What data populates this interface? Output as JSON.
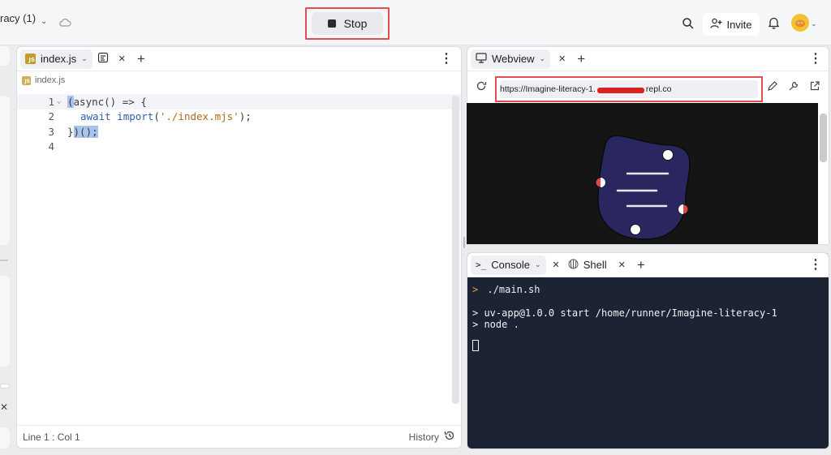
{
  "topbar": {
    "repl_title": "racy (1)",
    "stop_label": "Stop",
    "invite_label": "Invite"
  },
  "editor": {
    "tab_label": "index.js",
    "breadcrumb": "index.js",
    "code_lines": [
      {
        "num": "1"
      },
      {
        "num": "2"
      },
      {
        "num": "3"
      },
      {
        "num": "4"
      }
    ],
    "code": {
      "l1_bracket": "(",
      "l1_rest": "async() => {",
      "l2_kw": "await",
      "l2_fn": "import",
      "l2_open": "(",
      "l2_str": "'./index.mjs'",
      "l2_close": ");",
      "l3_a": "}",
      "l3_b": ")();"
    },
    "status_position": "Line 1 : Col 1",
    "history_label": "History"
  },
  "webview": {
    "tab_label": "Webview",
    "url_prefix": "https://Imagine-literacy-1.",
    "url_suffix": "repl.co"
  },
  "console": {
    "tab_console": "Console",
    "tab_shell": "Shell",
    "lines": {
      "run": "./main.sh",
      "start": "> uv-app@1.0.0 start /home/runner/Imagine-literacy-1",
      "node": "> node ."
    },
    "run_prompt": ">"
  },
  "colors": {
    "highlight_border": "#e05050",
    "console_bg": "#1c2333",
    "preview_bg": "#151515",
    "blob_fill": "#2a2760"
  }
}
